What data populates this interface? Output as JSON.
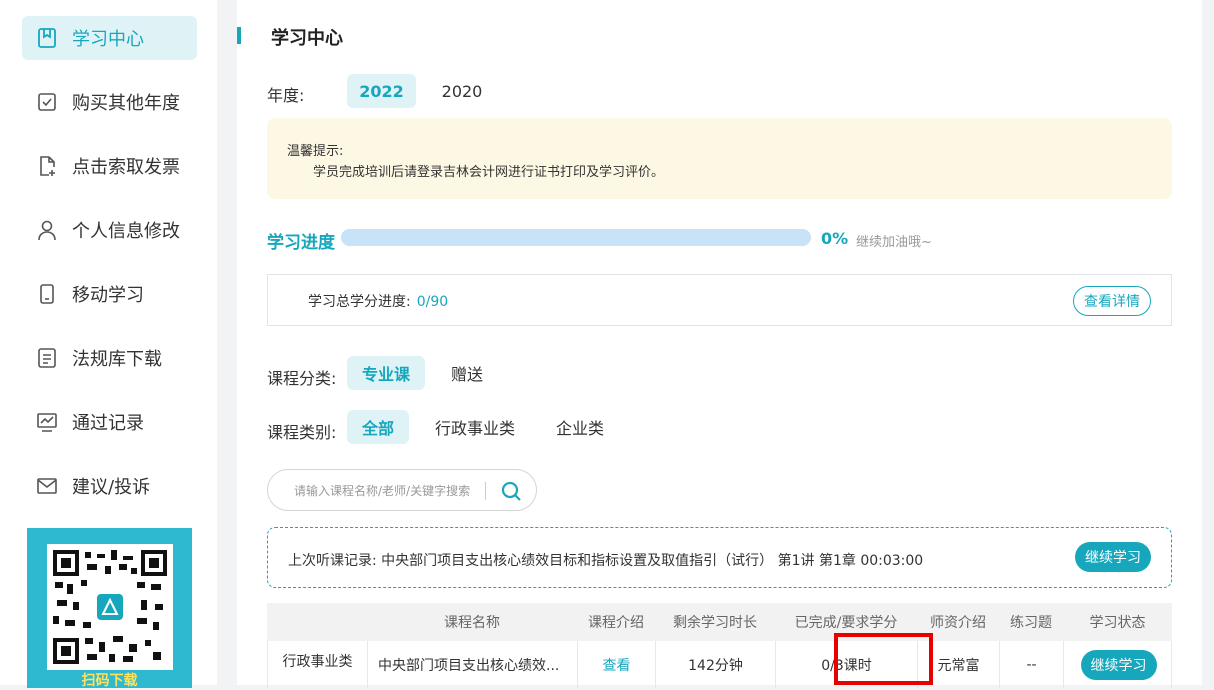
{
  "sidebar": {
    "items": [
      {
        "label": "学习中心",
        "icon": "bookmark-icon",
        "active": true
      },
      {
        "label": "购买其他年度",
        "icon": "checkbox-icon",
        "active": false
      },
      {
        "label": "点击索取发票",
        "icon": "file-plus-icon",
        "active": false
      },
      {
        "label": "个人信息修改",
        "icon": "user-icon",
        "active": false
      },
      {
        "label": "移动学习",
        "icon": "mobile-icon",
        "active": false
      },
      {
        "label": "法规库下载",
        "icon": "document-icon",
        "active": false
      },
      {
        "label": "通过记录",
        "icon": "chart-icon",
        "active": false
      },
      {
        "label": "建议/投诉",
        "icon": "mail-icon",
        "active": false
      }
    ],
    "qr_caption": "扫码下载"
  },
  "page": {
    "title": "学习中心",
    "year_label": "年度:",
    "years": [
      "2022",
      "2020"
    ],
    "tip_title": "温馨提示:",
    "tip_text": "学员完成培训后请登录吉林会计网进行证书打印及学习评价。",
    "progress_label": "学习进度",
    "progress_value": 0,
    "progress_pct": "0%",
    "progress_encourage": "继续加油哦~",
    "credit_label": "学习总学分进度:",
    "credit_value": "0/90",
    "credit_detail_btn": "查看详情",
    "category_label": "课程分类:",
    "categories": [
      "专业课",
      "赠送"
    ],
    "type_label": "课程类别:",
    "types": [
      "全部",
      "行政事业类",
      "企业类"
    ],
    "search_placeholder": "请输入课程名称/老师/关键字搜索",
    "last_record": "上次听课记录: 中央部门项目支出核心绩效目标和指标设置及取值指引（试行） 第1讲 第1章 00:03:00",
    "continue_btn": "继续学习"
  },
  "table": {
    "headers": [
      "课程名称",
      "课程介绍",
      "剩余学习时长",
      "已完成/要求学分",
      "师资介绍",
      "练习题",
      "学习状态"
    ],
    "rows": [
      {
        "category": "行政事业类",
        "name": "中央部门项目支出核心绩效...",
        "intro": "查看",
        "remaining": "142分钟",
        "credits": "0/3课时",
        "teacher": "元常富",
        "exercise": "--",
        "status": "继续学习"
      }
    ]
  },
  "colors": {
    "accent": "#17a7bd",
    "highlight": "#e60000",
    "tip_bg": "#fdf8e4"
  }
}
